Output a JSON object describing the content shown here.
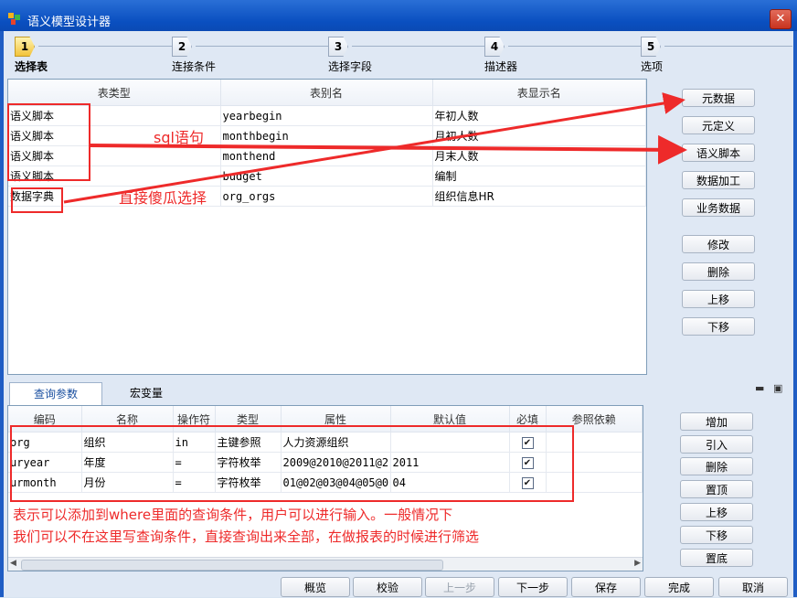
{
  "window": {
    "title": "语义模型设计器",
    "close_glyph": "✕"
  },
  "steps": [
    {
      "num": "1",
      "label": "选择表"
    },
    {
      "num": "2",
      "label": "连接条件"
    },
    {
      "num": "3",
      "label": "选择字段"
    },
    {
      "num": "4",
      "label": "描述器"
    },
    {
      "num": "5",
      "label": "选项"
    }
  ],
  "table_grid": {
    "columns": [
      "表类型",
      "表别名",
      "表显示名"
    ],
    "rows": [
      [
        "语义脚本",
        "yearbegin",
        "年初人数"
      ],
      [
        "语义脚本",
        "monthbegin",
        "月初人数"
      ],
      [
        "语义脚本",
        "monthend",
        "月末人数"
      ],
      [
        "语义脚本",
        "budget",
        "编制"
      ],
      [
        "数据字典",
        "org_orgs",
        "组织信息HR"
      ]
    ]
  },
  "right_buttons": [
    "元数据",
    "元定义",
    "语义脚本",
    "数据加工",
    "业务数据",
    "修改",
    "删除",
    "上移",
    "下移"
  ],
  "tabs": [
    "查询参数",
    "宏变量"
  ],
  "param_grid": {
    "columns": [
      "编码",
      "名称",
      "操作符",
      "类型",
      "属性",
      "默认值",
      "必填",
      "参照依赖"
    ],
    "rows": [
      [
        "org",
        "组织",
        "in",
        "主键参照",
        "人力资源组织",
        "",
        "✔",
        ""
      ],
      [
        "uryear",
        "年度",
        "=",
        "字符枚举",
        "2009@2010@2011@2...",
        "2011",
        "✔",
        ""
      ],
      [
        "urmonth",
        "月份",
        "=",
        "字符枚举",
        "01@02@03@04@05@0...",
        "04",
        "✔",
        ""
      ]
    ]
  },
  "param_buttons": [
    "增加",
    "引入",
    "删除",
    "置顶",
    "上移",
    "下移",
    "置底"
  ],
  "bottom_buttons": [
    "概览",
    "校验",
    "上一步",
    "下一步",
    "保存",
    "完成",
    "取消"
  ],
  "annotations": {
    "sql": "sql语句",
    "choose": "直接傻瓜选择",
    "note_line1": "表示可以添加到where里面的查询条件，用户可以进行输入。一般情况下",
    "note_line2": "我们可以不在这里写查询条件，直接查询出来全部，在做报表的时候进行筛选"
  },
  "colors": {
    "title_bar": "#0a4fc0",
    "annotation": "#ee2a2a",
    "panel_bg": "#dfe8f4"
  }
}
